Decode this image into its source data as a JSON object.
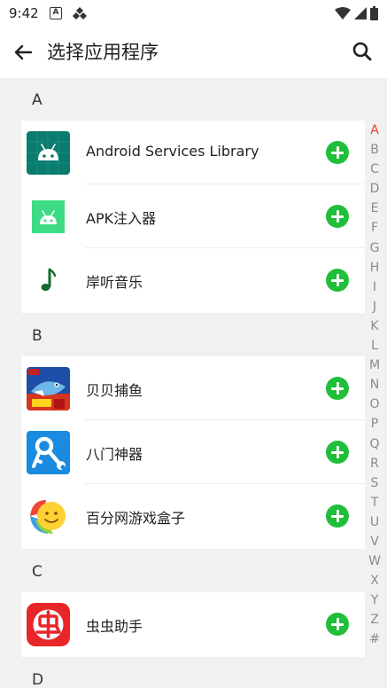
{
  "status_bar": {
    "time": "9:42",
    "icons": [
      "notification-a-icon",
      "notification-diamond-icon",
      "wifi-icon",
      "signal-icon",
      "battery-icon"
    ]
  },
  "app_bar": {
    "title": "选择应用程序",
    "back_icon": "arrow-left-icon",
    "search_icon": "search-icon"
  },
  "colors": {
    "add_button": "#1fbf3a",
    "index_active": "#e53935",
    "background": "#f1f1f1"
  },
  "sections": [
    {
      "letter": "A",
      "apps": [
        {
          "name": "Android Services Library",
          "icon": "android-icon-dark"
        },
        {
          "name": "APK注入器",
          "icon": "android-icon-green"
        },
        {
          "name": "岸听音乐",
          "icon": "music-note-icon"
        }
      ]
    },
    {
      "letter": "B",
      "apps": [
        {
          "name": "贝贝捕鱼",
          "icon": "fishing-game-icon"
        },
        {
          "name": "八门神器",
          "icon": "key-wrench-icon"
        },
        {
          "name": "百分网游戏盒子",
          "icon": "smiley-gamebox-icon"
        }
      ]
    },
    {
      "letter": "C",
      "apps": [
        {
          "name": "虫虫助手",
          "icon": "bug-assistant-icon"
        }
      ]
    },
    {
      "letter": "D",
      "apps": []
    }
  ],
  "index_bar": {
    "letters": [
      "A",
      "B",
      "C",
      "D",
      "E",
      "F",
      "G",
      "H",
      "I",
      "J",
      "K",
      "L",
      "M",
      "N",
      "O",
      "P",
      "Q",
      "R",
      "S",
      "T",
      "U",
      "V",
      "W",
      "X",
      "Y",
      "Z",
      "#"
    ],
    "active": "A"
  }
}
